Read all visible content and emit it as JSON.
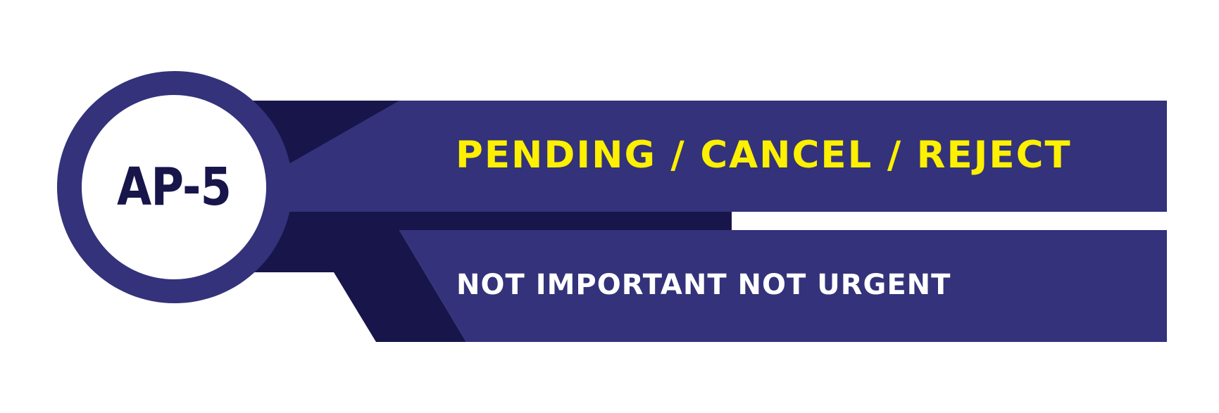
{
  "badge": {
    "code": "AP-5"
  },
  "status": {
    "label": "PENDING / CANCEL / REJECT"
  },
  "priority": {
    "label": "NOT IMPORTANT NOT URGENT"
  },
  "colors": {
    "navy": "#33327a",
    "dark_navy": "#17154a",
    "yellow": "#fdf000",
    "white": "#ffffff"
  }
}
